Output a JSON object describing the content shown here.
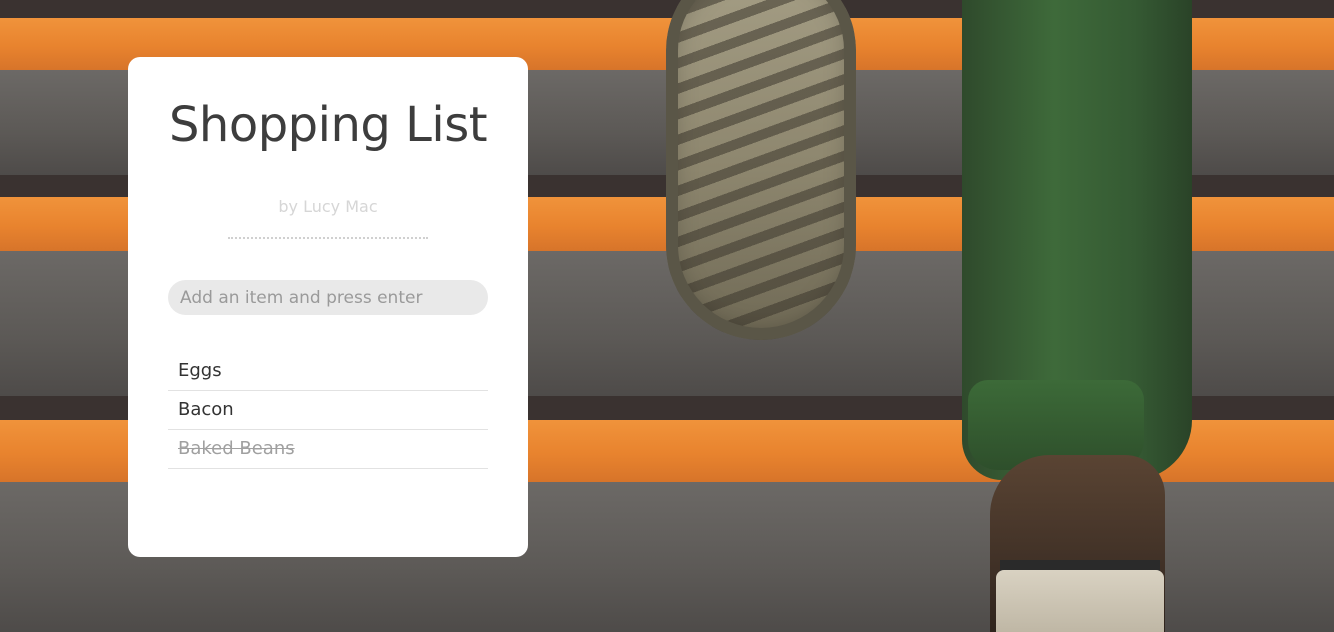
{
  "app": {
    "title": "Shopping List",
    "byline": "by Lucy Mac"
  },
  "add_item": {
    "placeholder": "Add an item and press enter",
    "value": ""
  },
  "items": [
    {
      "label": "Eggs",
      "done": false
    },
    {
      "label": "Bacon",
      "done": false
    },
    {
      "label": "Baked Beans",
      "done": true
    }
  ],
  "colors": {
    "card_background": "#ffffff",
    "title": "#3d3d3d",
    "byline": "#d6d6d6",
    "input_background": "#e9e9e9",
    "done_item": "#a0a0a0",
    "stair_orange": "#e8832e",
    "pants_green": "#3e6a3a"
  }
}
